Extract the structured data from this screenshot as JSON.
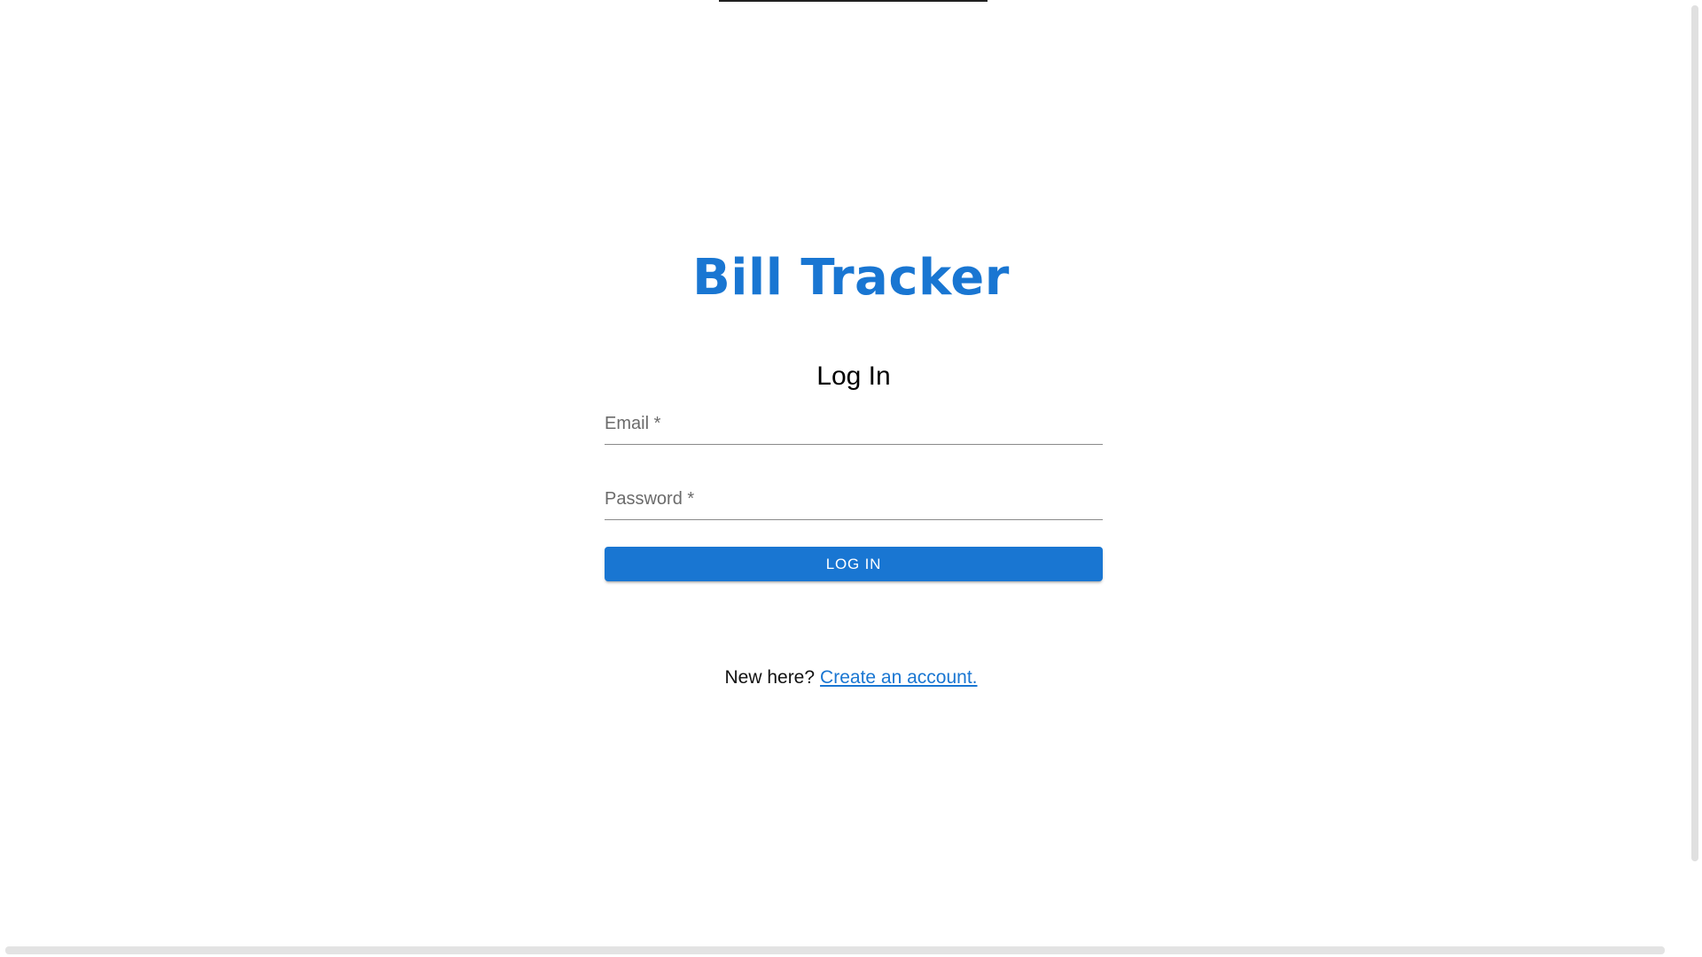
{
  "app": {
    "title": "Bill Tracker"
  },
  "login_form": {
    "heading": "Log In",
    "email_label": "Email *",
    "password_label": "Password *",
    "submit_label": "Log In"
  },
  "signup": {
    "prompt": "New here?",
    "link_text": "Create an account."
  },
  "colors": {
    "primary": "#1976d2",
    "background": "#ffffff",
    "field_underline": "#8a8a8a"
  }
}
